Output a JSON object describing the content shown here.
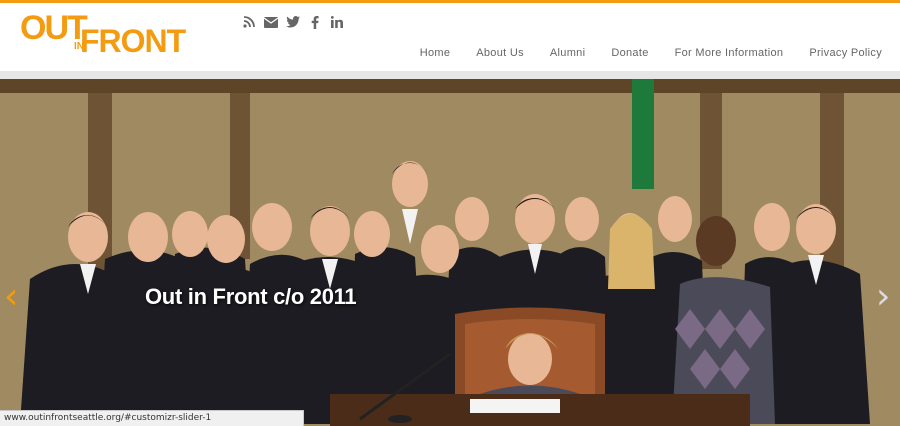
{
  "brand": {
    "logo_out": "OUT",
    "logo_in": "IN",
    "logo_front": "FRONT",
    "accent": "#f39c12"
  },
  "social": [
    {
      "name": "rss-icon",
      "glyph": "⊃"
    },
    {
      "name": "email-icon",
      "glyph": "✉"
    },
    {
      "name": "twitter-icon",
      "glyph": "🐦"
    },
    {
      "name": "facebook-icon",
      "glyph": "f"
    },
    {
      "name": "linkedin-icon",
      "glyph": "in"
    }
  ],
  "nav": {
    "home": "Home",
    "about": "About Us",
    "alumni": "Alumni",
    "donate": "Donate",
    "more_info": "For More Information",
    "privacy": "Privacy Policy"
  },
  "slider": {
    "caption": "Out in Front c/o 2011",
    "prev_glyph": "‹",
    "next_glyph": "›"
  },
  "status": {
    "url": "www.outinfrontseattle.org/#customizr-slider-1"
  }
}
